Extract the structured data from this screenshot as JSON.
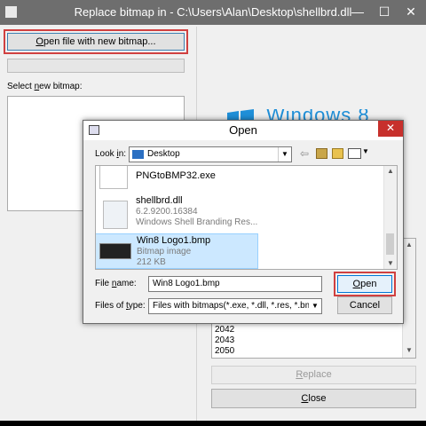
{
  "main": {
    "title": "Replace bitmap in - C:\\Users\\Alan\\Desktop\\shellbrd.dll",
    "open_button": {
      "prefix": "O",
      "rest": "pen file with new bitmap..."
    },
    "select_label": {
      "prefix": "Select ",
      "ul": "n",
      "rest": "ew bitmap:"
    },
    "banner_text": "Windows 8",
    "resources": [
      "2042",
      "2043",
      "2050"
    ],
    "replace_button": {
      "ul": "R",
      "rest": "eplace"
    },
    "close_button": {
      "ul": "C",
      "rest": "lose"
    },
    "titlebar_buttons": {
      "minimize": "—",
      "maximize": "☐",
      "close": "✕"
    }
  },
  "dialog": {
    "title": "Open",
    "close_glyph": "✕",
    "lookin_label": {
      "prefix": "Look ",
      "ul": "i",
      "rest": "n:"
    },
    "lookin_value": "Desktop",
    "files": [
      {
        "name": "PNGtoBMP32.exe",
        "line2": "",
        "line3": ""
      },
      {
        "name": "shellbrd.dll",
        "line2": "6.2.9200.16384",
        "line3": "Windows Shell Branding Res..."
      },
      {
        "name": "Win8 Logo1.bmp",
        "line2": "Bitmap image",
        "line3": "212 KB"
      }
    ],
    "filename_label": {
      "prefix": "File ",
      "ul": "n",
      "rest": "ame:"
    },
    "filename_value": "Win8 Logo1.bmp",
    "filetype_label": {
      "prefix": "Files of ",
      "ul": "t",
      "rest": "ype:"
    },
    "filetype_value": "Files with bitmaps(*.exe, *.dll, *.res, *.bmp)",
    "open_button": {
      "ul": "O",
      "rest": "pen"
    },
    "cancel_button": "Cancel"
  },
  "colors": {
    "accent": "#0078d7",
    "close_red": "#c7302c",
    "titlebar": "#6e6e6e",
    "selection": "#cce8ff"
  }
}
